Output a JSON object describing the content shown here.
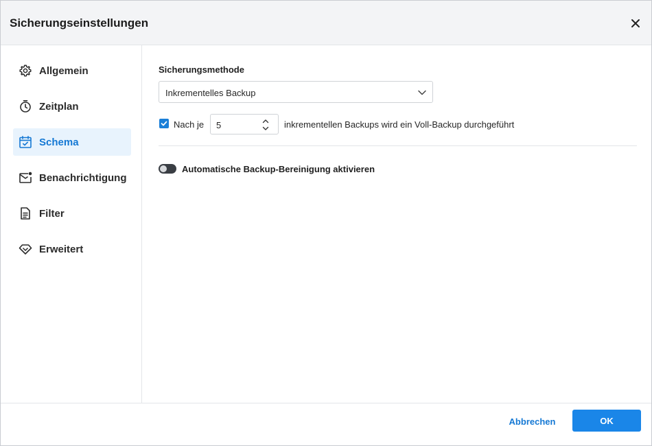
{
  "dialog": {
    "title": "Sicherungseinstellungen",
    "close_icon": "close-icon"
  },
  "sidebar": {
    "items": [
      {
        "label": "Allgemein",
        "icon": "gear-icon",
        "active": false
      },
      {
        "label": "Zeitplan",
        "icon": "stopwatch-icon",
        "active": false
      },
      {
        "label": "Schema",
        "icon": "calendar-check-icon",
        "active": true
      },
      {
        "label": "Benachrichtigung",
        "icon": "mail-notification-icon",
        "active": false
      },
      {
        "label": "Filter",
        "icon": "document-filter-icon",
        "active": false
      },
      {
        "label": "Erweitert",
        "icon": "diamond-icon",
        "active": false
      }
    ]
  },
  "schema": {
    "method_label": "Sicherungsmethode",
    "method_value": "Inkrementelles Backup",
    "full_backup_checkbox_checked": true,
    "nach_label": "Nach je",
    "interval_value": "5",
    "interval_suffix": "inkrementellen Backups wird ein Voll-Backup durchgeführt",
    "cleanup_toggle_on": false,
    "cleanup_label": "Automatische Backup-Bereinigung aktivieren"
  },
  "footer": {
    "cancel_label": "Abbrechen",
    "ok_label": "OK"
  },
  "colors": {
    "accent": "#1a86e8",
    "active_nav_bg": "#e8f3fd",
    "active_nav_text": "#1478d4",
    "toggle_off": "#3a3e44"
  }
}
